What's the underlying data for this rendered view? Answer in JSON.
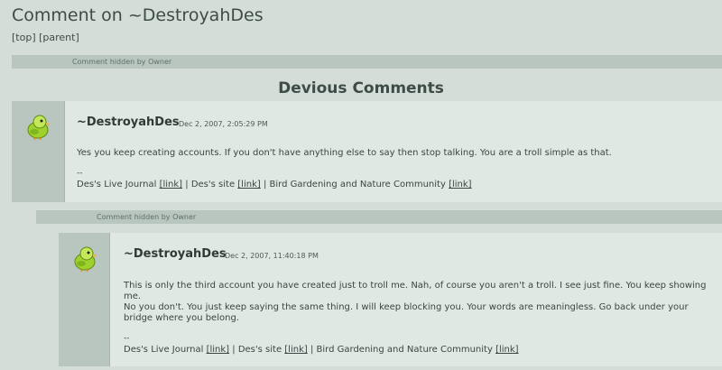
{
  "page": {
    "title": "Comment on ~DestroyahDes",
    "nav": {
      "top": "[top]",
      "parent": "[parent]"
    }
  },
  "hidden_notice_1": "Comment hidden by Owner",
  "section_title": "Devious Comments",
  "comments": [
    {
      "author": "~DestroyahDes",
      "date": "Dec 2, 2007, 2:05:29 PM",
      "text": "Yes you keep creating accounts. If you don't have anything else to say then stop talking. You are a troll simple as that.",
      "sig_dash": "--",
      "sig": {
        "journal": "Des's Live Journal",
        "link1": "[link]",
        "sep1": "|",
        "site": "Des's site",
        "link2": "[link]",
        "sep2": "|",
        "community": "Bird Gardening and Nature Community",
        "link3": "[link]"
      }
    },
    {
      "author": "~DestroyahDes",
      "date": "Dec 2, 2007, 11:40:18 PM",
      "text1": "This is only the third account you have created just to troll me. Nah, of course you aren't a troll. I see just fine. You keep showing me.",
      "text2": "No you don't. You just keep saying the same thing. I will keep blocking you. Your words are meaningless. Go back under your bridge where you belong.",
      "sig_dash": "--",
      "sig": {
        "journal": "Des's Live Journal",
        "link1": "[link]",
        "sep1": "|",
        "site": "Des's site",
        "link2": "[link]",
        "sep2": "|",
        "community": "Bird Gardening and Nature Community",
        "link3": "[link]"
      }
    }
  ],
  "hidden_notice_2": "Comment hidden by Owner",
  "colors": {
    "background": "#d4ddd8",
    "bar": "#b9c6bf",
    "card": "#dfe8e3",
    "avatar": "#9fd12e"
  },
  "icons": {
    "avatar": "yellow-green-bird-avatar"
  }
}
